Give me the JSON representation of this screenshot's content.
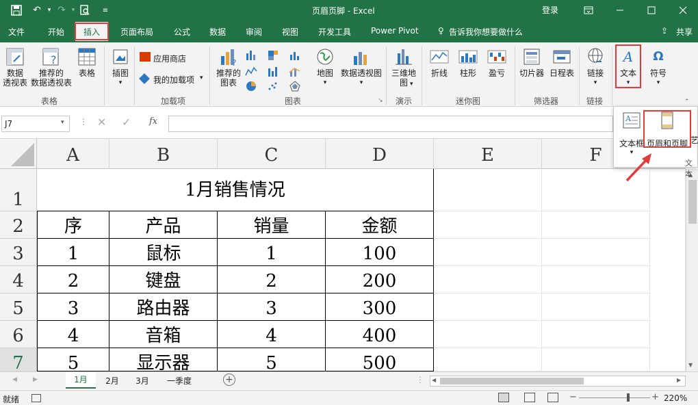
{
  "window": {
    "title": "页眉页脚 - Excel",
    "login": "登录"
  },
  "tabs": [
    {
      "label": "文件"
    },
    {
      "label": "开始"
    },
    {
      "label": "插入"
    },
    {
      "label": "页面布局"
    },
    {
      "label": "公式"
    },
    {
      "label": "数据"
    },
    {
      "label": "审阅"
    },
    {
      "label": "视图"
    },
    {
      "label": "开发工具"
    },
    {
      "label": "Power Pivot"
    }
  ],
  "tell_me": "告诉我你想要做什么",
  "share": "共享",
  "ribbon": {
    "pivot_table": "数据\n透视表",
    "recommended_pivot": "推荐的\n数据透视表",
    "table": "表格",
    "illustrations": "插图",
    "app_store": "应用商店",
    "my_addins": "我的加载项",
    "recommended_charts": "推荐的\n图表",
    "map": "地图",
    "pivot_chart": "数据透视图",
    "map3d": "三维地\n图",
    "line": "折线",
    "column": "柱形",
    "win_loss": "盈亏",
    "slicer": "切片器",
    "timeline": "日程表",
    "link": "链接",
    "text": "文本",
    "symbol": "符号",
    "groups": {
      "tables": "表格",
      "addins": "加载项",
      "charts": "图表",
      "tours": "演示",
      "sparklines": "迷你图",
      "filters": "筛选器",
      "links": "链接"
    }
  },
  "text_popup": {
    "textbox": "文本框",
    "header_footer": "页眉和页脚",
    "wordart": "艺",
    "group": "文本"
  },
  "formula_bar": {
    "name_box": "J7",
    "fx": "fx",
    "value": ""
  },
  "columns": [
    "A",
    "B",
    "C",
    "D",
    "E",
    "F"
  ],
  "rows": [
    "1",
    "2",
    "3",
    "4",
    "5",
    "6",
    "7"
  ],
  "sheet": {
    "title": "1月销售情况",
    "headers": [
      "序",
      "产品",
      "销量",
      "金额"
    ],
    "data": [
      [
        "1",
        "鼠标",
        "1",
        "100"
      ],
      [
        "2",
        "键盘",
        "2",
        "200"
      ],
      [
        "3",
        "路由器",
        "3",
        "300"
      ],
      [
        "4",
        "音箱",
        "4",
        "400"
      ],
      [
        "5",
        "显示器",
        "5",
        "500"
      ]
    ]
  },
  "sheet_tabs": [
    "1月",
    "2月",
    "3月",
    "一季度"
  ],
  "status": {
    "ready": "就绪",
    "zoom": "220%"
  },
  "colors": {
    "excel_green": "#217346",
    "highlight_red": "#e03a3a"
  }
}
